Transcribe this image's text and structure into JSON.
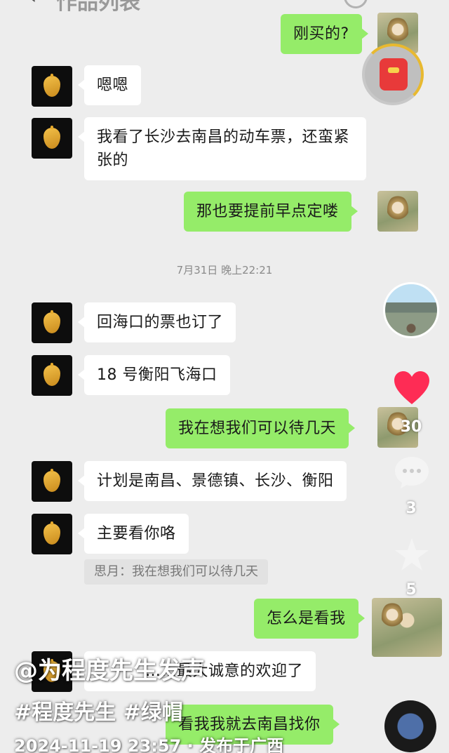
{
  "header": {
    "back_icon": "back-arrow-icon",
    "title": "作品列表"
  },
  "messages": [
    {
      "side": "right",
      "text": "刚买的?"
    },
    {
      "side": "left",
      "text": "嗯嗯"
    },
    {
      "side": "left",
      "text": "我看了长沙去南昌的动车票，还蛮紧张的"
    },
    {
      "side": "right",
      "text": "那也要提前早点定喽"
    },
    {
      "side": "left",
      "text": "回海口的票也订了"
    },
    {
      "side": "left",
      "text": "18 号衡阳飞海口"
    },
    {
      "side": "right",
      "text": "我在想我们可以待几天"
    },
    {
      "side": "left",
      "text": "计划是南昌、景德镇、长沙、衡阳"
    },
    {
      "side": "left",
      "text": "主要看你咯"
    },
    {
      "side": "right",
      "text": "怎么是看我"
    },
    {
      "side": "left",
      "text": "……最大诚意的欢迎了"
    },
    {
      "side": "right",
      "text": "看我我就去南昌找你"
    }
  ],
  "timestamp": "7月31日 晚上22:21",
  "quote": "思月：我在想我们可以待几天",
  "side_actions": {
    "like_count": "30",
    "comment_count": "3",
    "favorite_count": "5",
    "like_color": "#fe2c55"
  },
  "overlay": {
    "author": "@为程度先生发声",
    "hashtags": "#程度先生 #绿帽",
    "post_time": "2024-11-19 23:57 · 发布于广西"
  },
  "colors": {
    "bubble_right": "#95ec69",
    "bubble_left": "#ffffff",
    "background": "#ededed"
  }
}
